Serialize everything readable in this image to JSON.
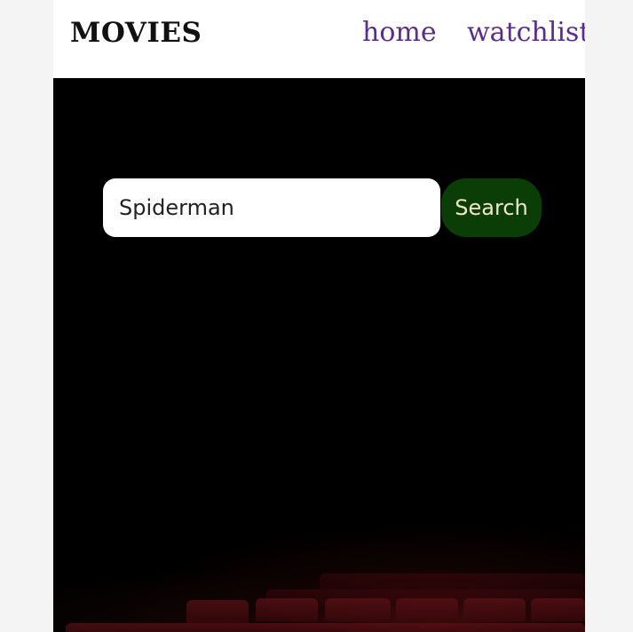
{
  "navbar": {
    "brand": "MOVIES",
    "links": [
      {
        "label": "home"
      },
      {
        "label": "watchlist"
      }
    ]
  },
  "search": {
    "value": "Spiderman",
    "button_label": "Search"
  },
  "colors": {
    "nav_link": "#5b2d8a",
    "hero_background": "#000000",
    "search_button_bg": "#0b3d06",
    "search_button_text": "#f0e6c6",
    "theater_seats": "#5a1116"
  }
}
